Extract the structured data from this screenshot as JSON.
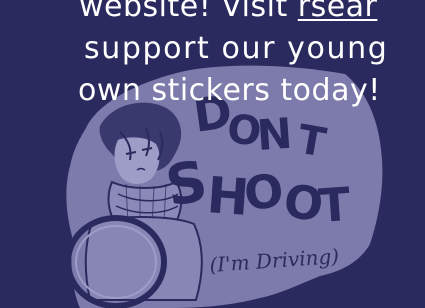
{
  "intro": {
    "line1_before_link": "website! Visit ",
    "link_text": "rsear",
    "line2": "support our young",
    "line3": "own stickers today!"
  },
  "sticker": {
    "icon": "sticker-illustration",
    "title_text": "DONT SHOOT",
    "caption_text": "(I'm Driving)"
  },
  "colors": {
    "background": "#2b2a5e",
    "sticker_fill": "#7c7bab",
    "sticker_ink": "#2b2a5e",
    "text": "#ffffff"
  }
}
